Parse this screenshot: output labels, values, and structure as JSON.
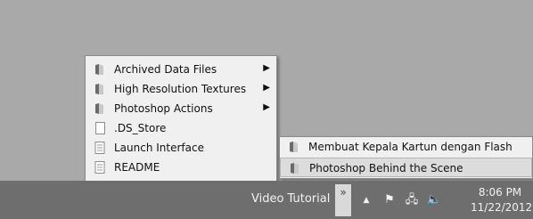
{
  "menu": {
    "items": [
      {
        "label": "Archived Data Files",
        "icon": "folder-icon",
        "has_submenu": true
      },
      {
        "label": "High Resolution Textures",
        "icon": "folder-icon",
        "has_submenu": true
      },
      {
        "label": "Photoshop Actions",
        "icon": "folder-icon",
        "has_submenu": true
      },
      {
        "label": ".DS_Store",
        "icon": "file-icon",
        "has_submenu": false
      },
      {
        "label": "Launch Interface",
        "icon": "text-file-icon",
        "has_submenu": false
      },
      {
        "label": "README",
        "icon": "text-file-icon",
        "has_submenu": false
      }
    ],
    "submenu_arrow": "▶"
  },
  "submenu": {
    "items": [
      {
        "label": "Membuat Kepala Kartun dengan Flash",
        "icon": "folder-icon"
      },
      {
        "label": "Photoshop Behind the Scene",
        "icon": "folder-icon",
        "highlighted": true
      }
    ]
  },
  "taskbar": {
    "toolbar_label": "Video Tutorial",
    "chevron": "»",
    "tray": {
      "show_hidden_icon": "▲",
      "flag_icon": "⚑",
      "network_icon": "🖧",
      "volume_icon": "🔈"
    },
    "time": "8:06 PM",
    "date": "11/22/2012"
  }
}
